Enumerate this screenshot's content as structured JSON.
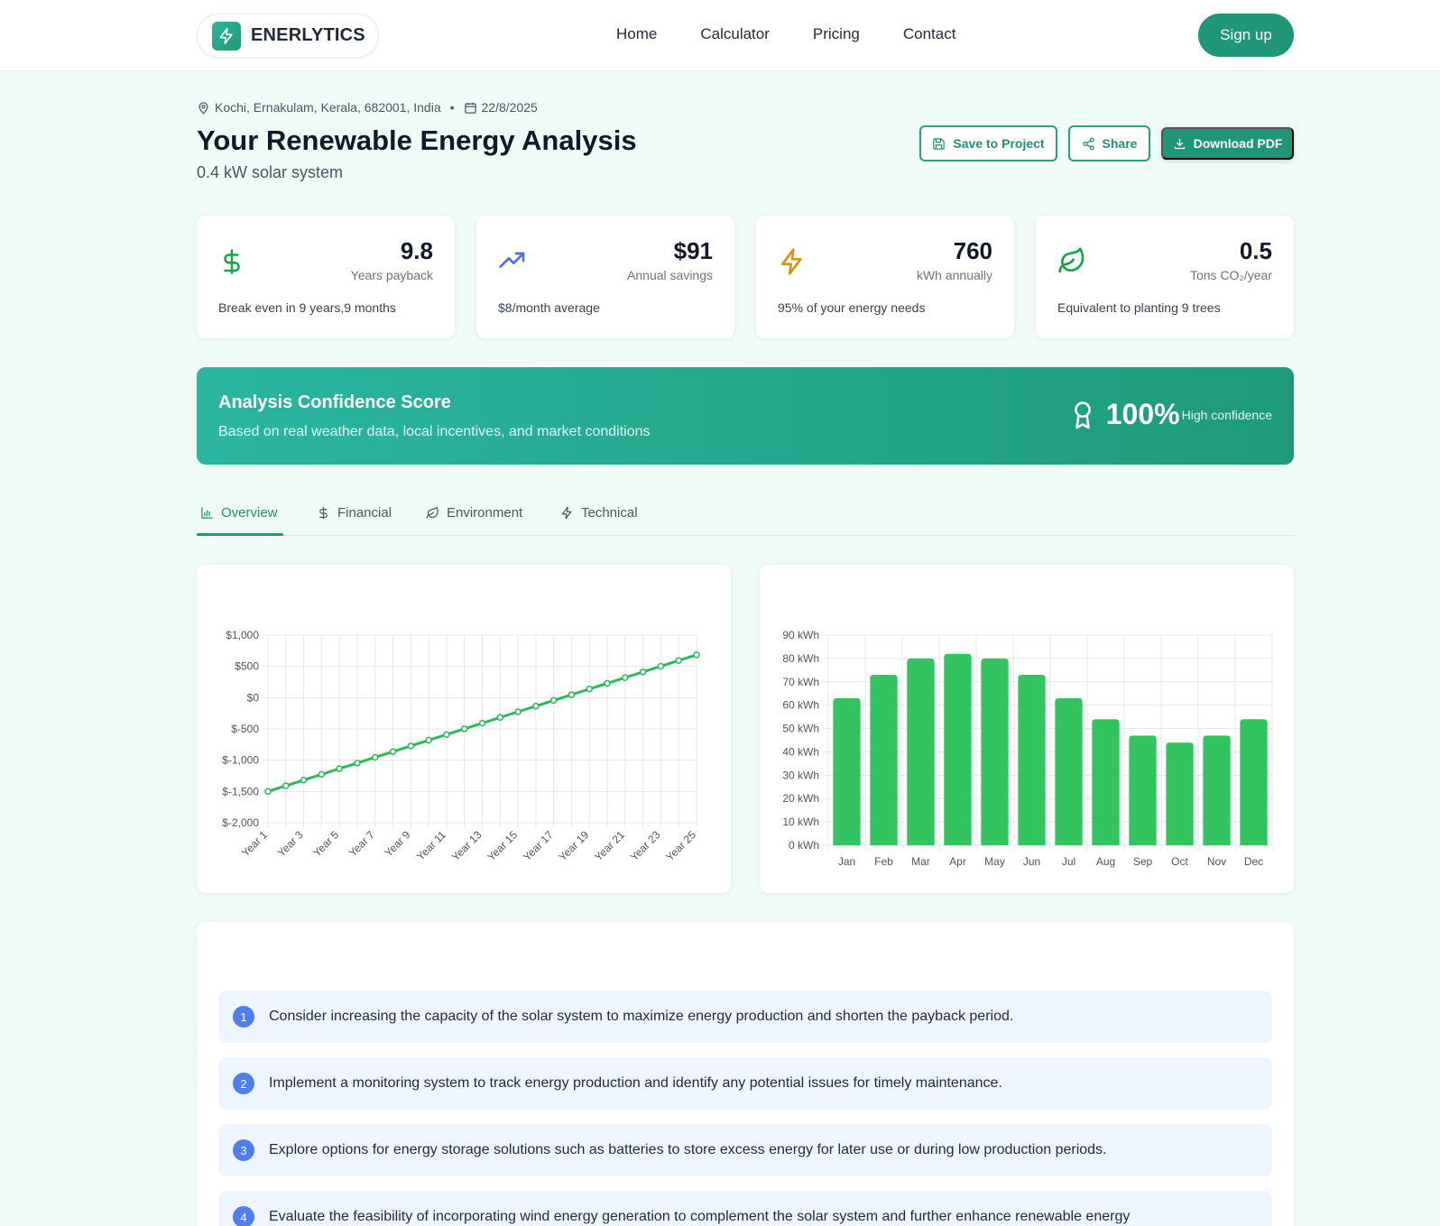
{
  "nav": {
    "brand": "ENERLYTICS",
    "links": [
      "Home",
      "Calculator",
      "Pricing",
      "Contact"
    ],
    "signup": "Sign up"
  },
  "header": {
    "location": "Kochi, Ernakulam, Kerala, 682001, India",
    "separator": "•",
    "date": "22/8/2025",
    "title": "Your Renewable Energy Analysis",
    "subtitle": "0.4 kW solar system",
    "save_label": "Save to Project",
    "share_label": "Share",
    "download_label": "Download PDF"
  },
  "stats": [
    {
      "value": "9.8",
      "label": "Years payback",
      "footer": "Break even in 9 years,9 months",
      "icon": "dollar-icon",
      "color": "#16a34a"
    },
    {
      "value": "$91",
      "label": "Annual savings",
      "footer": "$8/month average",
      "icon": "trending-up-icon",
      "color": "#4f6fe0"
    },
    {
      "value": "760",
      "label": "kWh annually",
      "footer": "95% of your energy needs",
      "icon": "lightning-icon",
      "color": "#d4921a"
    },
    {
      "value": "0.5",
      "label": "Tons CO₂/year",
      "footer": "Equivalent to planting 9 trees",
      "icon": "leaf-icon",
      "color": "#16a34a"
    }
  ],
  "confidence": {
    "title": "Analysis Confidence Score",
    "subtitle": "Based on real weather data, local incentives, and market conditions",
    "percent": "100%",
    "label": "High confidence"
  },
  "tabs": [
    {
      "label": "Overview",
      "icon": "bar-chart-icon",
      "active": true
    },
    {
      "label": "Financial",
      "icon": "dollar-icon",
      "active": false
    },
    {
      "label": "Environment",
      "icon": "leaf-icon",
      "active": false
    },
    {
      "label": "Technical",
      "icon": "lightning-icon",
      "active": false
    }
  ],
  "chart_data": [
    {
      "type": "line",
      "x": [
        "Year 1",
        "Year 2",
        "Year 3",
        "Year 4",
        "Year 5",
        "Year 6",
        "Year 7",
        "Year 8",
        "Year 9",
        "Year 10",
        "Year 11",
        "Year 12",
        "Year 13",
        "Year 14",
        "Year 15",
        "Year 16",
        "Year 17",
        "Year 18",
        "Year 19",
        "Year 20",
        "Year 21",
        "Year 22",
        "Year 23",
        "Year 24",
        "Year 25"
      ],
      "x_tick_labels": [
        "Year 1",
        "Year 3",
        "Year 5",
        "Year 7",
        "Year 9",
        "Year 11",
        "Year 13",
        "Year 15",
        "Year 17",
        "Year 19",
        "Year 21",
        "Year 23",
        "Year 25"
      ],
      "series": [
        {
          "values": [
            -1500,
            -1409,
            -1318,
            -1227,
            -1136,
            -1045,
            -954,
            -863,
            -772,
            -681,
            -590,
            -499,
            -408,
            -317,
            -226,
            -135,
            -44,
            47,
            138,
            229,
            320,
            411,
            502,
            593,
            684
          ],
          "color": "#2db85a"
        }
      ],
      "y_ticks": [
        -2000,
        -1500,
        -1000,
        -500,
        0,
        500,
        1000
      ],
      "y_tick_labels": [
        "$-2,000",
        "$-1,500",
        "$-1,000",
        "$-500",
        "$0",
        "$500",
        "$1,000"
      ],
      "ylim": [
        -2000,
        1000
      ],
      "grid": true
    },
    {
      "type": "bar",
      "categories": [
        "Jan",
        "Feb",
        "Mar",
        "Apr",
        "May",
        "Jun",
        "Jul",
        "Aug",
        "Sep",
        "Oct",
        "Nov",
        "Dec"
      ],
      "series": [
        {
          "values": [
            63,
            73,
            80,
            82,
            80,
            73,
            63,
            54,
            47,
            44,
            47,
            54
          ],
          "color": "#33c45f"
        }
      ],
      "y_ticks": [
        0,
        10,
        20,
        30,
        40,
        50,
        60,
        70,
        80,
        90
      ],
      "y_tick_labels": [
        "0 kWh",
        "10 kWh",
        "20 kWh",
        "30 kWh",
        "40 kWh",
        "50 kWh",
        "60 kWh",
        "70 kWh",
        "80 kWh",
        "90 kWh"
      ],
      "ylim": [
        0,
        90
      ],
      "grid": true
    }
  ],
  "recommendations": [
    {
      "num": "1",
      "text": "Consider increasing the capacity of the solar system to maximize energy production and shorten the payback period."
    },
    {
      "num": "2",
      "text": "Implement a monitoring system to track energy production and identify any potential issues for timely maintenance."
    },
    {
      "num": "3",
      "text": "Explore options for energy storage solutions such as batteries to store excess energy for later use or during low production periods."
    },
    {
      "num": "4",
      "text": "Evaluate the feasibility of incorporating wind energy generation to complement the solar system and further enhance renewable energy"
    }
  ]
}
